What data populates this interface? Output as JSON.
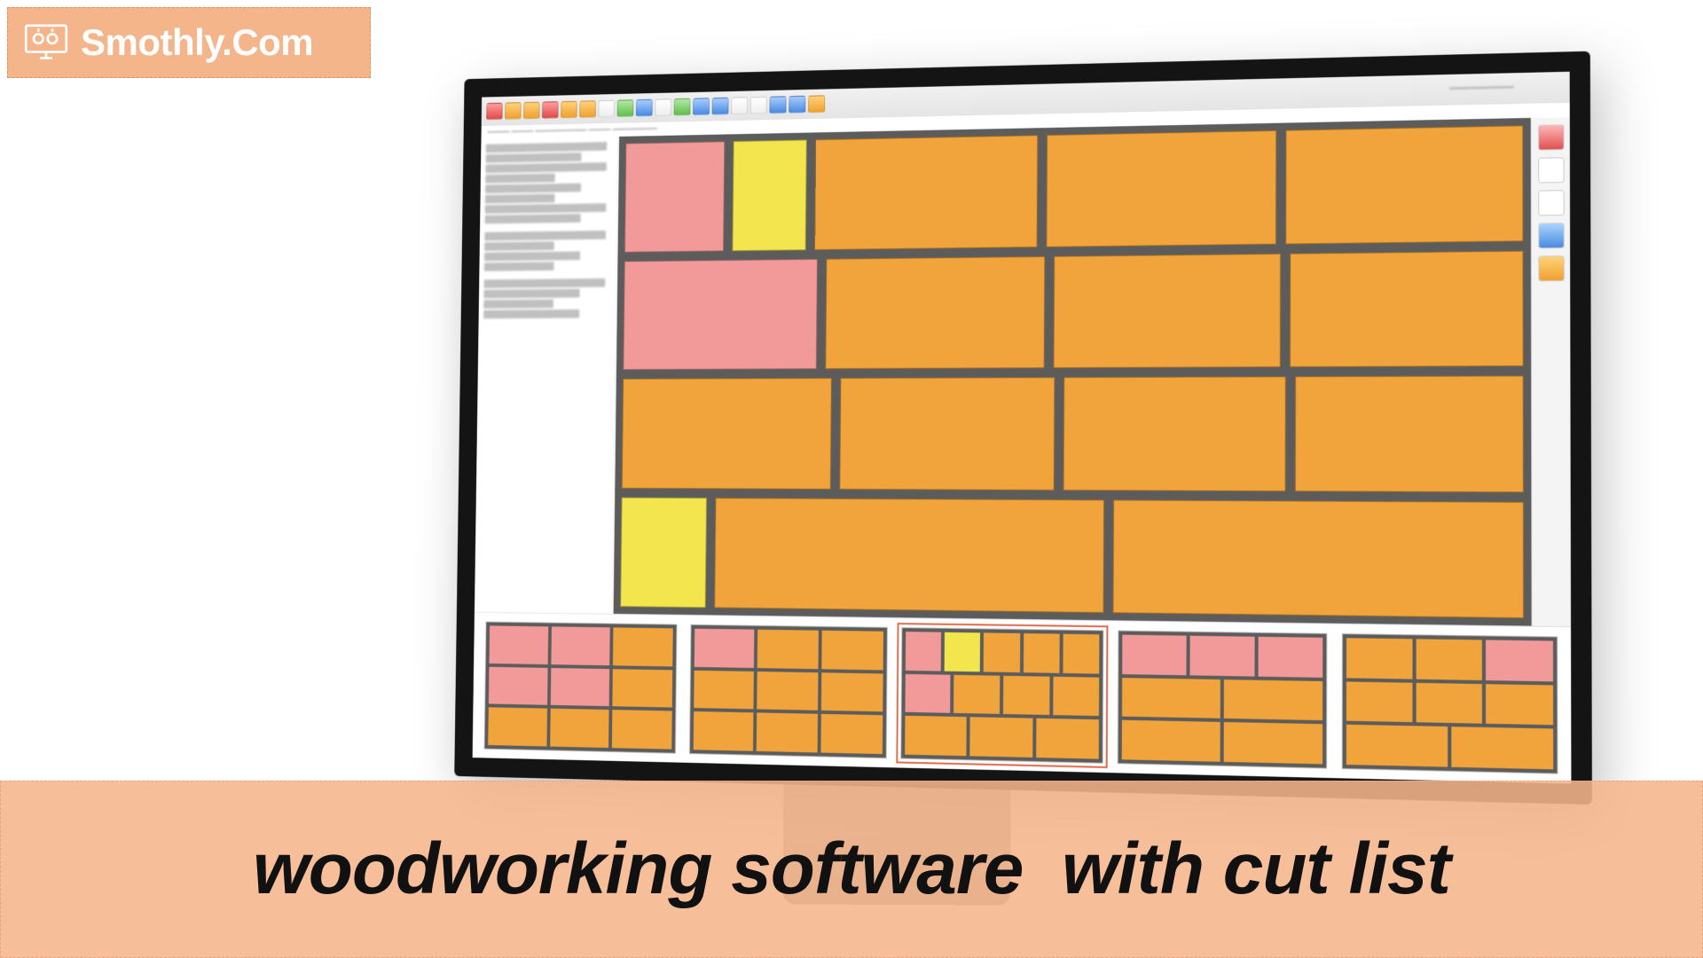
{
  "logo": {
    "text": "Smothly.Com"
  },
  "caption": {
    "text": "woodworking software  with cut list"
  },
  "app": {
    "main_sheet": {
      "rows": [
        {
          "pieces": [
            {
              "label": "",
              "color": "pink",
              "flex": 1.1
            },
            {
              "label": "",
              "color": "yellow",
              "flex": 0.8
            },
            {
              "label": "",
              "color": "orange",
              "flex": 2.4
            },
            {
              "label": "",
              "color": "orange",
              "flex": 2.4
            },
            {
              "label": "",
              "color": "orange",
              "flex": 2.4
            }
          ]
        },
        {
          "pieces": [
            {
              "label": "",
              "color": "pink",
              "flex": 2.0
            },
            {
              "label": "",
              "color": "orange",
              "flex": 2.2
            },
            {
              "label": "",
              "color": "orange",
              "flex": 2.2
            },
            {
              "label": "",
              "color": "orange",
              "flex": 2.2
            }
          ]
        },
        {
          "pieces": [
            {
              "label": "",
              "color": "orange",
              "flex": 2.1
            },
            {
              "label": "",
              "color": "orange",
              "flex": 2.1
            },
            {
              "label": "",
              "color": "orange",
              "flex": 2.1
            },
            {
              "label": "",
              "color": "orange",
              "flex": 2.1
            }
          ]
        },
        {
          "pieces": [
            {
              "label": "",
              "color": "yellow",
              "flex": 0.9
            },
            {
              "label": "",
              "color": "orange",
              "flex": 4.0
            },
            {
              "label": "",
              "color": "orange",
              "flex": 4.0
            }
          ]
        }
      ]
    },
    "thumbnails": [
      {
        "selected": false,
        "rows": [
          [
            "pink",
            "pink",
            "orange"
          ],
          [
            "pink",
            "pink",
            "orange"
          ],
          [
            "orange",
            "orange",
            "orange"
          ]
        ]
      },
      {
        "selected": false,
        "rows": [
          [
            "pink",
            "orange",
            "orange"
          ],
          [
            "orange",
            "orange",
            "orange"
          ],
          [
            "orange",
            "orange",
            "orange"
          ]
        ]
      },
      {
        "selected": true,
        "rows": [
          [
            "pink",
            "yellow",
            "orange",
            "orange",
            "orange"
          ],
          [
            "pink",
            "orange",
            "orange",
            "orange"
          ],
          [
            "orange",
            "orange",
            "orange"
          ]
        ]
      },
      {
        "selected": false,
        "rows": [
          [
            "pink",
            "pink",
            "pink"
          ],
          [
            "orange",
            "orange"
          ],
          [
            "orange",
            "orange"
          ]
        ]
      },
      {
        "selected": false,
        "rows": [
          [
            "orange",
            "orange",
            "pink"
          ],
          [
            "orange",
            "orange",
            "orange"
          ],
          [
            "orange",
            "orange"
          ]
        ]
      }
    ]
  }
}
